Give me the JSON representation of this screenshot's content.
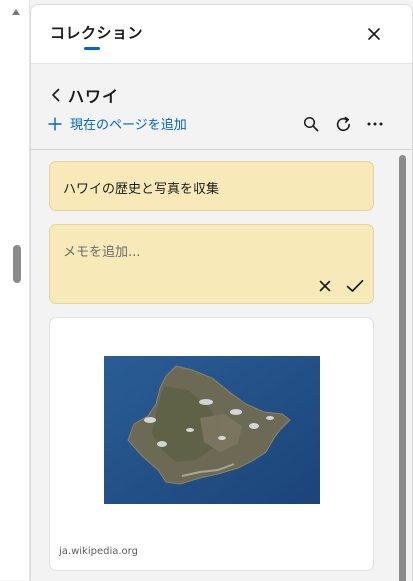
{
  "panel": {
    "title": "コレクション"
  },
  "collection": {
    "name": "ハワイ",
    "add_page_label": "現在のページを追加"
  },
  "notes": [
    {
      "text": "ハワイの歴史と写真を収集"
    }
  ],
  "note_editor": {
    "placeholder": "メモを追加..."
  },
  "saved_page": {
    "source": "ja.wikipedia.org",
    "image": "oahu-satellite-photo"
  },
  "colors": {
    "accent": "#0067c0",
    "note_bg": "#f8e9b8",
    "ocean": "#1f4f86"
  },
  "icons": [
    "close-icon",
    "chevron-left-icon",
    "plus-icon",
    "search-icon",
    "refresh-icon",
    "more-icon",
    "check-icon"
  ]
}
